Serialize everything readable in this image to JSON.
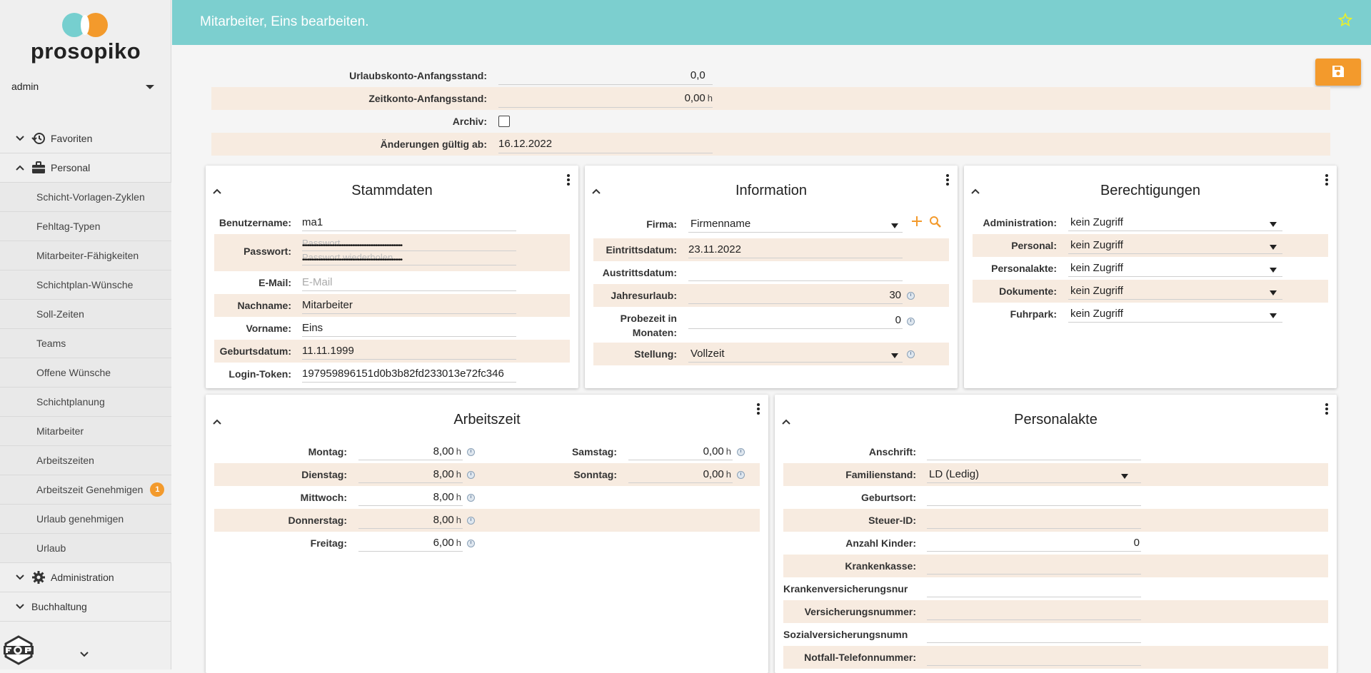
{
  "app": {
    "logo_text": "prosopiko",
    "user": "admin",
    "colors": {
      "accent_teal": "#7ccfcf",
      "accent_orange": "#f39a2c",
      "row_alt": "#f7ebe0"
    }
  },
  "sidebar": {
    "items": [
      {
        "label": "Favoriten",
        "icon": "history-icon",
        "expanded": false
      },
      {
        "label": "Personal",
        "icon": "briefcase-icon",
        "expanded": true
      },
      {
        "label": "Schicht-Vorlagen-Zyklen"
      },
      {
        "label": "Fehltag-Typen"
      },
      {
        "label": "Mitarbeiter-Fähigkeiten"
      },
      {
        "label": "Schichtplan-Wünsche"
      },
      {
        "label": "Soll-Zeiten"
      },
      {
        "label": "Teams"
      },
      {
        "label": "Offene Wünsche"
      },
      {
        "label": "Schichtplanung"
      },
      {
        "label": "Mitarbeiter"
      },
      {
        "label": "Arbeitszeiten"
      },
      {
        "label": "Arbeitszeit Genehmigen",
        "badge": "1"
      },
      {
        "label": "Urlaub genehmigen"
      },
      {
        "label": "Urlaub"
      },
      {
        "label": "Administration",
        "icon": "gear-icon",
        "expanded": false
      },
      {
        "label": "Buchhaltung",
        "expanded": false
      }
    ]
  },
  "header": {
    "title": "Mitarbeiter, Eins bearbeiten."
  },
  "topform": {
    "urlaubskonto_label": "Urlaubskonto-Anfangsstand:",
    "urlaubskonto_value": "0,0",
    "zeitkonto_label": "Zeitkonto-Anfangsstand:",
    "zeitkonto_value": "0,00",
    "zeitkonto_unit": "h",
    "archiv_label": "Archiv:",
    "archiv_checked": false,
    "gueltig_label": "Änderungen gültig ab:",
    "gueltig_value": "16.12.2022"
  },
  "stammdaten": {
    "title": "Stammdaten",
    "benutzername_label": "Benutzername:",
    "benutzername_value": "ma1",
    "passwort_label": "Passwort:",
    "passwort_placeholder": "Passwort",
    "passwort_repeat_placeholder": "Passwort wiederholen",
    "passwort_dots": "••••••••••••••••••••••••••••••••••••••••••••••••••••••••",
    "email_label": "E-Mail:",
    "email_placeholder": "E-Mail",
    "nachname_label": "Nachname:",
    "nachname_value": "Mitarbeiter",
    "vorname_label": "Vorname:",
    "vorname_value": "Eins",
    "geburtsdatum_label": "Geburtsdatum:",
    "geburtsdatum_value": "11.11.1999",
    "token_label": "Login-Token:",
    "token_value": "197959896151d0b3b82fd233013e72fc346"
  },
  "information": {
    "title": "Information",
    "firma_label": "Firma:",
    "firma_value": "Firmenname",
    "eintritt_label": "Eintrittsdatum:",
    "eintritt_value": "23.11.2022",
    "austritt_label": "Austrittsdatum:",
    "austritt_value": "",
    "urlaub_label": "Jahresurlaub:",
    "urlaub_value": "30",
    "probezeit_label_1": "Probezeit in",
    "probezeit_label_2": "Monaten:",
    "probezeit_value": "0",
    "stellung_label": "Stellung:",
    "stellung_value": "Vollzeit"
  },
  "berechtigungen": {
    "title": "Berechtigungen",
    "rows": [
      {
        "label": "Administration:",
        "value": "kein Zugriff"
      },
      {
        "label": "Personal:",
        "value": "kein Zugriff"
      },
      {
        "label": "Personalakte:",
        "value": "kein Zugriff"
      },
      {
        "label": "Dokumente:",
        "value": "kein Zugriff"
      },
      {
        "label": "Fuhrpark:",
        "value": "kein Zugriff"
      }
    ]
  },
  "arbeitszeit": {
    "title": "Arbeitszeit",
    "unit": "h",
    "left": [
      {
        "label": "Montag:",
        "value": "8,00"
      },
      {
        "label": "Dienstag:",
        "value": "8,00"
      },
      {
        "label": "Mittwoch:",
        "value": "8,00"
      },
      {
        "label": "Donnerstag:",
        "value": "8,00"
      },
      {
        "label": "Freitag:",
        "value": "6,00"
      }
    ],
    "right": [
      {
        "label": "Samstag:",
        "value": "0,00"
      },
      {
        "label": "Sonntag:",
        "value": "0,00"
      }
    ]
  },
  "personalakte": {
    "title": "Personalakte",
    "rows": [
      {
        "label": "Anschrift:",
        "value": ""
      },
      {
        "label": "Familienstand:",
        "value": "LD (Ledig)"
      },
      {
        "label": "Geburtsort:",
        "value": ""
      },
      {
        "label": "Steuer-ID:",
        "value": ""
      },
      {
        "label": "Anzahl Kinder:",
        "value": "0"
      },
      {
        "label": "Krankenkasse:",
        "value": ""
      },
      {
        "label": "Krankenversicherungsnur",
        "value": ""
      },
      {
        "label": "Versicherungsnummer:",
        "value": ""
      },
      {
        "label": "Sozialversicherungsnumn",
        "value": ""
      },
      {
        "label": "Notfall-Telefonnummer:",
        "value": ""
      }
    ]
  }
}
